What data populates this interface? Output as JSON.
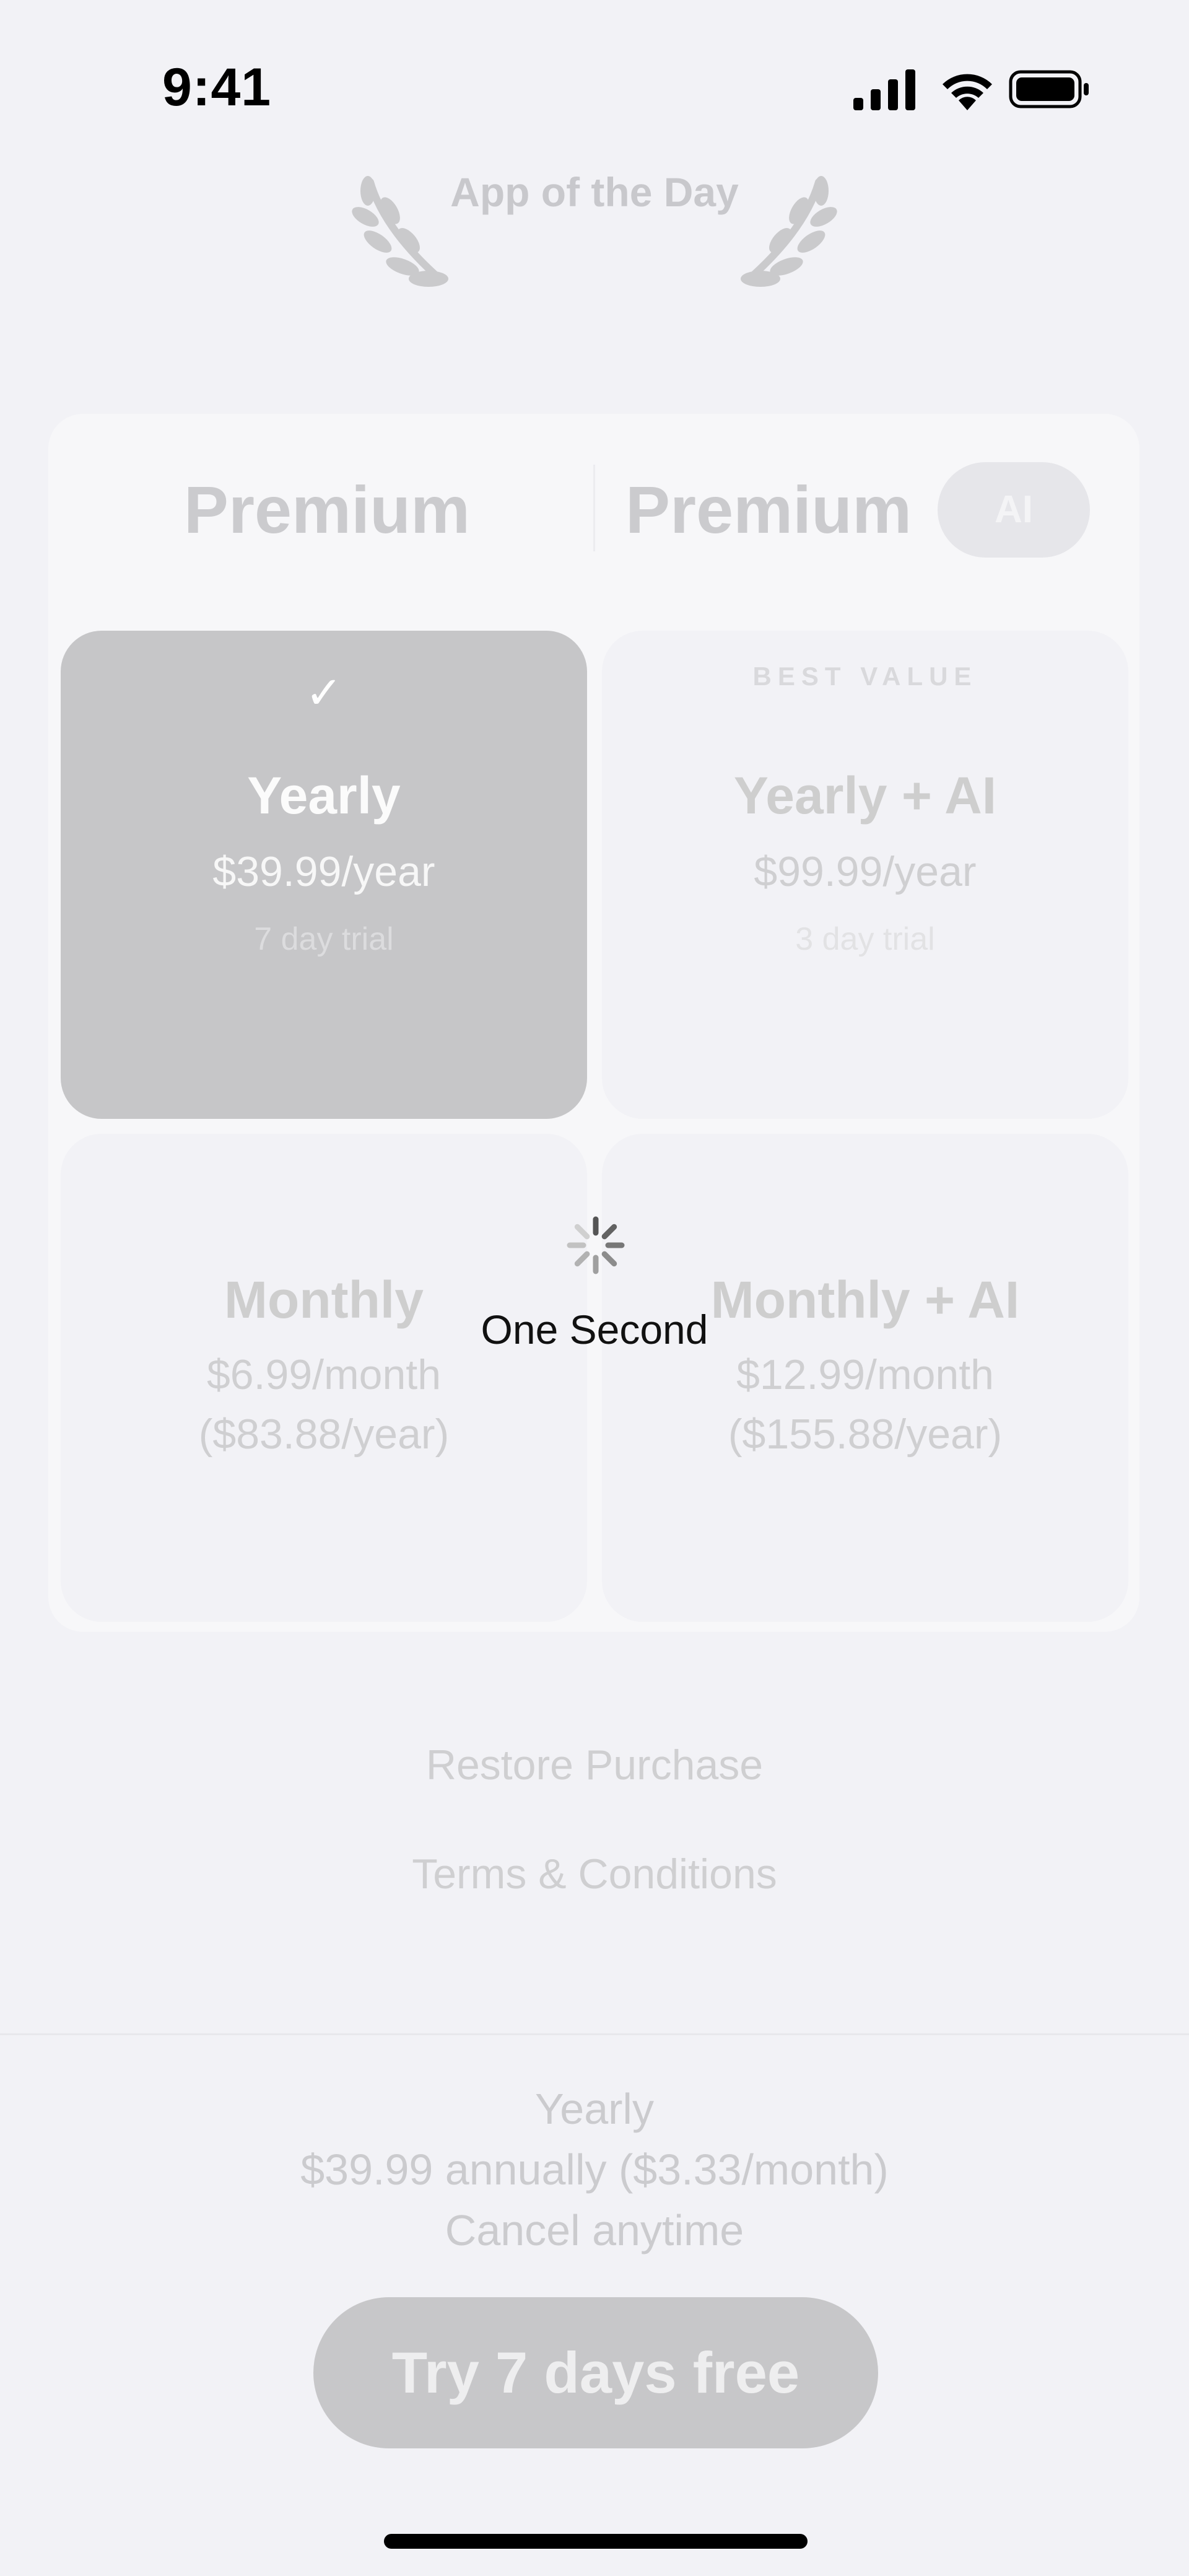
{
  "status_bar": {
    "time": "9:41",
    "icons": [
      "signal-icon",
      "wifi-icon",
      "battery-icon"
    ]
  },
  "badge": {
    "text": "App of the Day"
  },
  "plan_tabs": {
    "left_label": "Premium",
    "right_label": "Premium",
    "ai_badge": "AI"
  },
  "plans": [
    {
      "name": "Yearly",
      "price": "$39.99/year",
      "detail": "7 day trial",
      "selected": true
    },
    {
      "tag": "BEST VALUE",
      "name": "Yearly + AI",
      "price": "$99.99/year",
      "detail": "3 day trial",
      "selected": false
    },
    {
      "name": "Monthly",
      "price": "$6.99/month",
      "detail": "($83.88/year)",
      "selected": false
    },
    {
      "name": "Monthly + AI",
      "price": "$12.99/month",
      "detail": "($155.88/year)",
      "selected": false
    }
  ],
  "loading": {
    "text": "One Second"
  },
  "links": {
    "restore": "Restore Purchase",
    "terms": "Terms & Conditions"
  },
  "summary": {
    "plan": "Yearly",
    "price_line": "$39.99 annually ($3.33/month)",
    "cancel_line": "Cancel anytime"
  },
  "cta": {
    "label": "Try 7 days free"
  },
  "colors": {
    "background": "#f2f2f6",
    "selected_card": "#c6c6c8",
    "cta": "#c7c7c9",
    "muted_text": "#cbcbce"
  }
}
